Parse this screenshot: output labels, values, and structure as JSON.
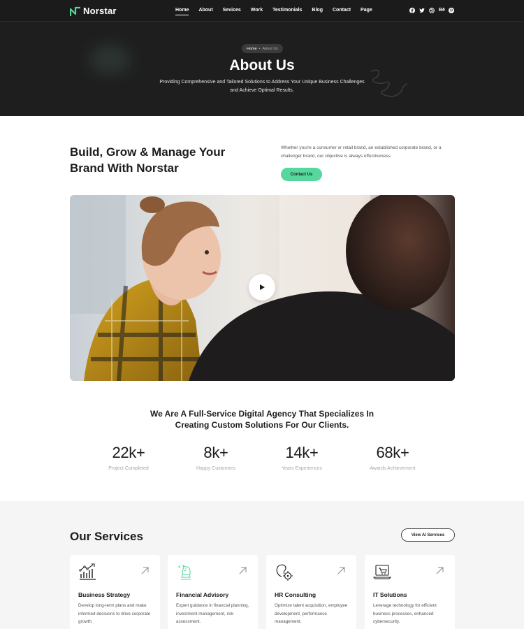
{
  "brand": {
    "name": "Norstar",
    "accent": "#56d79c"
  },
  "nav": {
    "items": [
      {
        "label": "Home",
        "active": true
      },
      {
        "label": "About"
      },
      {
        "label": "Sevices"
      },
      {
        "label": "Work"
      },
      {
        "label": "Testimonials"
      },
      {
        "label": "Blog"
      },
      {
        "label": "Contact"
      },
      {
        "label": "Page"
      }
    ],
    "socials": [
      "facebook-icon",
      "twitter-icon",
      "dribbble-icon",
      "behance-icon",
      "pinterest-icon"
    ],
    "behance_text": "Bē"
  },
  "hero": {
    "breadcrumb": {
      "home": "Home",
      "separator": "•",
      "current": "About Us"
    },
    "title": "About Us",
    "subtitle": "Providing Comprehensive and Tailored Solutions to Address Your Unique Business Challenges and Achieve Optimal Results."
  },
  "intro": {
    "title": "Build, Grow & Manage Your Brand With Norstar",
    "text": "Whether you're a consumer or retail brand, an established corporate brand, or a challenger brand, our objective is always effectiveness.",
    "cta": "Contact Us"
  },
  "video": {
    "play_icon": "play-icon"
  },
  "agency": {
    "headline": "We Are A Full-Service Digital Agency That Specializes In Creating Custom Solutions For Our Clients."
  },
  "stats": [
    {
      "value": "22k+",
      "label": "Project Completed"
    },
    {
      "value": "8k+",
      "label": "Happy Customers"
    },
    {
      "value": "14k+",
      "label": "Years Experiences"
    },
    {
      "value": "68k+",
      "label": "Awards Achievement"
    }
  ],
  "services": {
    "title": "Our Services",
    "view_all": "View Al Services",
    "cards": [
      {
        "icon": "chart-growth-icon",
        "title": "Business Strategy",
        "text": "Develop long-term plans and make informed decisions to drive corporate growth."
      },
      {
        "icon": "chess-knight-icon",
        "title": "Financial Advisory",
        "text": "Expert guidance in financial planning, investment management, risk assessment."
      },
      {
        "icon": "hr-target-icon",
        "title": "HR Consulting",
        "text": "Optimize talent acquisition, employee development, performance management."
      },
      {
        "icon": "laptop-cart-icon",
        "title": "IT Solutions",
        "text": "Leverage technology for efficient business processes, enhanced cybersecurity."
      }
    ]
  }
}
